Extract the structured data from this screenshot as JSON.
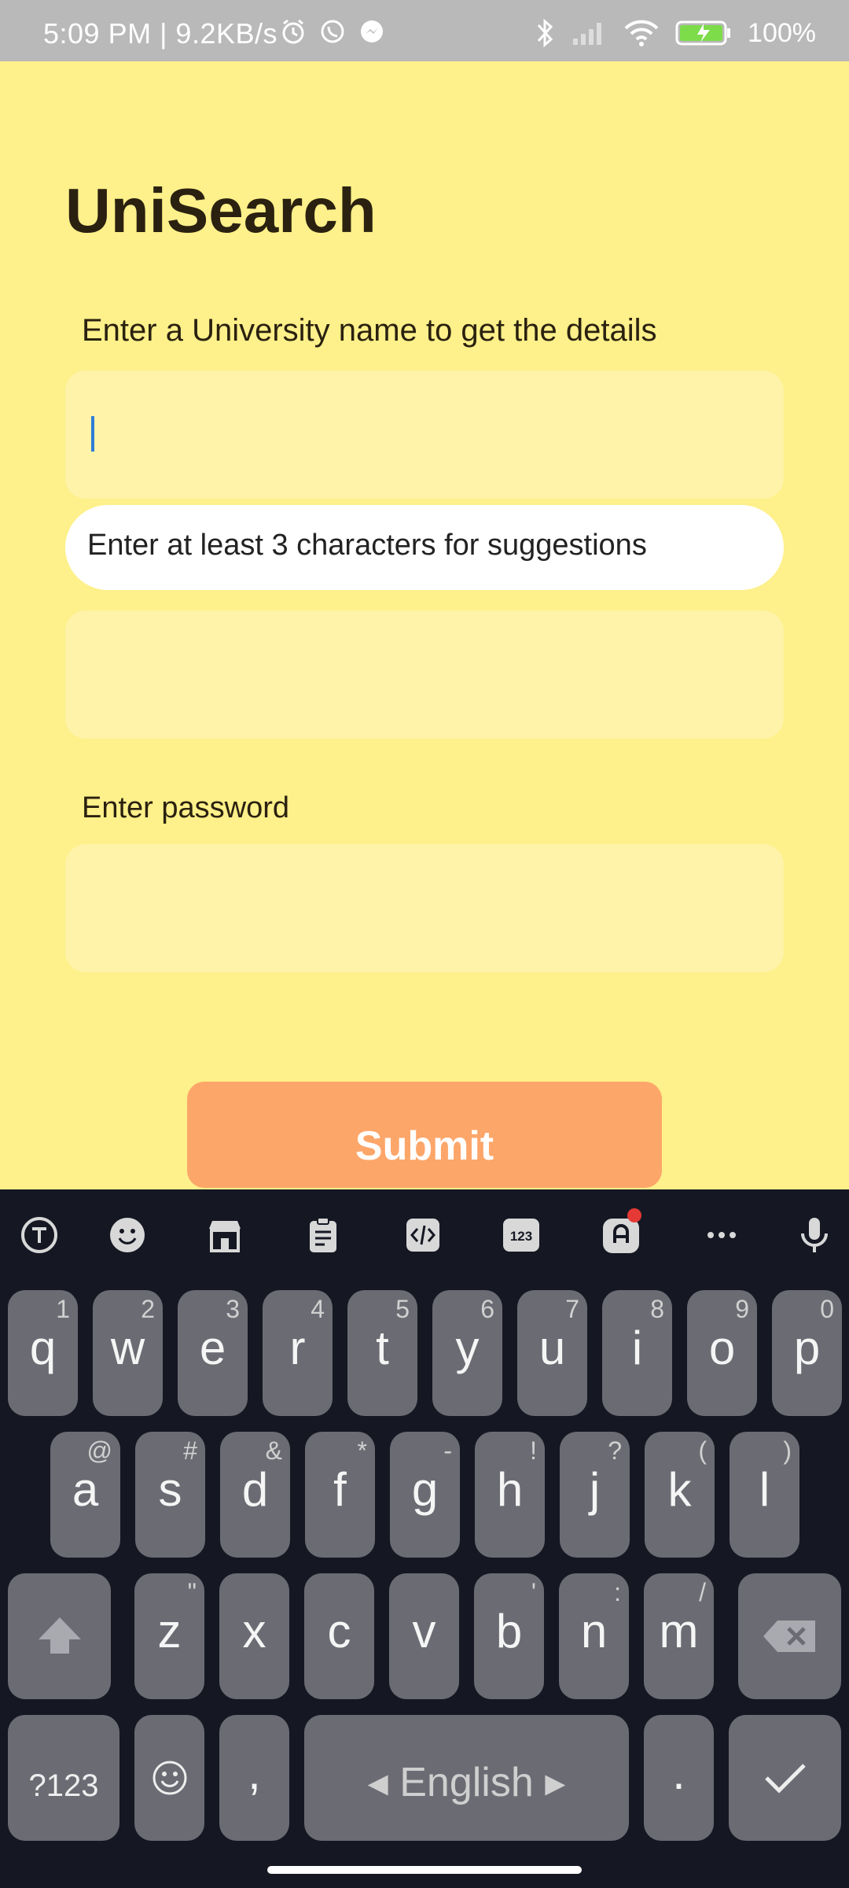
{
  "status_bar": {
    "time_speed": "5:09 PM | 9.2KB/s",
    "battery": "100%"
  },
  "app": {
    "title": "UniSearch",
    "university_label": "Enter a University name to get the details",
    "university_value": "",
    "suggestion_hint": "Enter at least 3 characters for suggestions",
    "second_field_value": "",
    "password_label": "Enter password",
    "password_value": "",
    "submit_label": "Submit"
  },
  "keyboard": {
    "row1": [
      {
        "k": "q",
        "a": "1"
      },
      {
        "k": "w",
        "a": "2"
      },
      {
        "k": "e",
        "a": "3"
      },
      {
        "k": "r",
        "a": "4"
      },
      {
        "k": "t",
        "a": "5"
      },
      {
        "k": "y",
        "a": "6"
      },
      {
        "k": "u",
        "a": "7"
      },
      {
        "k": "i",
        "a": "8"
      },
      {
        "k": "o",
        "a": "9"
      },
      {
        "k": "p",
        "a": "0"
      }
    ],
    "row2": [
      {
        "k": "a",
        "a": "@"
      },
      {
        "k": "s",
        "a": "#"
      },
      {
        "k": "d",
        "a": "&"
      },
      {
        "k": "f",
        "a": "*"
      },
      {
        "k": "g",
        "a": "-"
      },
      {
        "k": "h",
        "a": "!"
      },
      {
        "k": "j",
        "a": "?"
      },
      {
        "k": "k",
        "a": "("
      },
      {
        "k": "l",
        "a": ")"
      }
    ],
    "row3": [
      {
        "k": "z",
        "a": "\""
      },
      {
        "k": "x",
        "a": ""
      },
      {
        "k": "c",
        "a": ""
      },
      {
        "k": "v",
        "a": ""
      },
      {
        "k": "b",
        "a": "'"
      },
      {
        "k": "n",
        "a": ":"
      },
      {
        "k": "m",
        "a": "/"
      }
    ],
    "symbols_label": "?123",
    "comma_label": ",",
    "space_label": "◂ English ▸",
    "period_label": ".",
    "toolbar_items": [
      "text-edit-icon",
      "emoji-icon",
      "store-icon",
      "clipboard-icon",
      "code-icon",
      "numpad-icon",
      "sticker-icon",
      "more-icon",
      "microphone-icon"
    ],
    "numpad_badge": "123"
  },
  "colors": {
    "background": "#fef08a",
    "field": "#fef3a8",
    "submit": "#fda66a",
    "keyboard_bg": "#151823",
    "key_bg": "#6b6c73"
  }
}
